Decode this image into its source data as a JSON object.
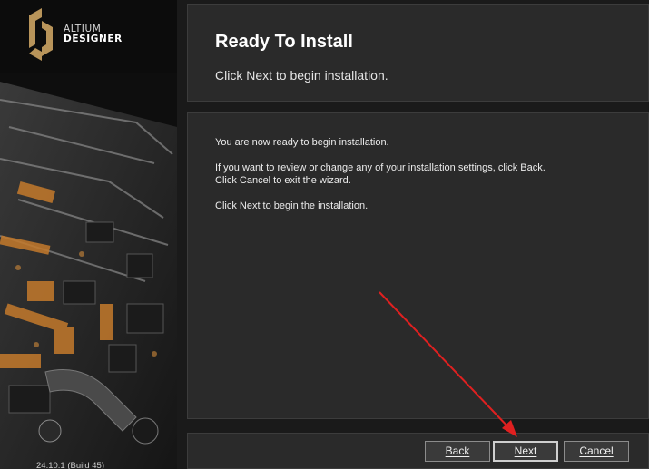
{
  "brand": {
    "line1": "ALTIUM",
    "line2": "DESIGNER",
    "version": "24.10.1 (Build 45)",
    "accent": "#b8945a"
  },
  "header": {
    "title": "Ready To Install",
    "subtitle": "Click Next to begin installation."
  },
  "body": {
    "line1": "You are now ready to begin installation.",
    "line2": "If you want to review or change any of your installation settings, click Back.",
    "line3": "Click Cancel to exit the wizard.",
    "line4": "Click Next to begin the installation."
  },
  "buttons": {
    "back": "Back",
    "next": "Next",
    "cancel": "Cancel"
  },
  "annotation": {
    "arrow_color": "#e02020"
  }
}
